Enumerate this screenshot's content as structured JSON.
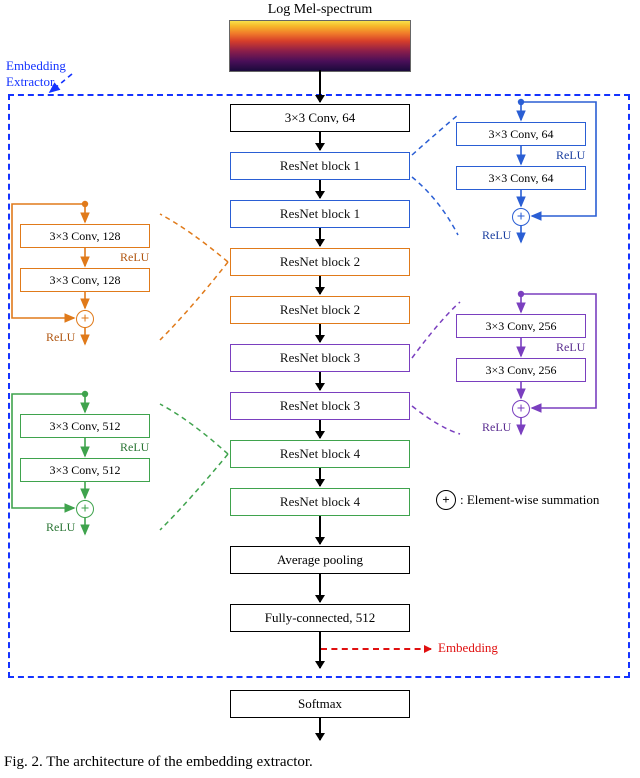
{
  "top_label": "Log Mel-spectrum",
  "extractor_label": "Embedding\nExtractor",
  "main_blocks": {
    "conv64": "3×3 Conv, 64",
    "res1a": "ResNet block 1",
    "res1b": "ResNet block 1",
    "res2a": "ResNet block 2",
    "res2b": "ResNet block 2",
    "res3a": "ResNet block 3",
    "res3b": "ResNet block 3",
    "res4a": "ResNet block 4",
    "res4b": "ResNet block 4",
    "avgpool": "Average pooling",
    "fc": "Fully-connected, 512",
    "softmax": "Softmax"
  },
  "details": {
    "blue": {
      "conv": "3×3 Conv, 64",
      "relu": "ReLU"
    },
    "orange": {
      "conv": "3×3 Conv, 128",
      "relu": "ReLU"
    },
    "purple": {
      "conv": "3×3 Conv, 256",
      "relu": "ReLU"
    },
    "green": {
      "conv": "3×3 Conv, 512",
      "relu": "ReLU"
    }
  },
  "legend": ": Element-wise summation",
  "embedding_label": "Embedding",
  "caption": "Fig. 2. The architecture of the embedding extractor.",
  "chart_data": {
    "type": "diagram",
    "title": "Architecture of the embedding extractor",
    "input": "Log Mel-spectrum",
    "pipeline": [
      {
        "name": "3×3 Conv, 64"
      },
      {
        "name": "ResNet block 1",
        "detail": [
          "3×3 Conv, 64",
          "ReLU",
          "3×3 Conv, 64",
          "element-wise sum",
          "ReLU"
        ],
        "color": "blue"
      },
      {
        "name": "ResNet block 1"
      },
      {
        "name": "ResNet block 2",
        "detail": [
          "3×3 Conv, 128",
          "ReLU",
          "3×3 Conv, 128",
          "element-wise sum",
          "ReLU"
        ],
        "color": "orange"
      },
      {
        "name": "ResNet block 2"
      },
      {
        "name": "ResNet block 3",
        "detail": [
          "3×3 Conv, 256",
          "ReLU",
          "3×3 Conv, 256",
          "element-wise sum",
          "ReLU"
        ],
        "color": "purple"
      },
      {
        "name": "ResNet block 3"
      },
      {
        "name": "ResNet block 4",
        "detail": [
          "3×3 Conv, 512",
          "ReLU",
          "3×3 Conv, 512",
          "element-wise sum",
          "ReLU"
        ],
        "color": "green"
      },
      {
        "name": "ResNet block 4"
      },
      {
        "name": "Average pooling"
      },
      {
        "name": "Fully-connected, 512",
        "output": "Embedding"
      },
      {
        "name": "Softmax"
      }
    ],
    "embedding_extractor_span": [
      "3×3 Conv, 64",
      "Fully-connected, 512"
    ]
  }
}
